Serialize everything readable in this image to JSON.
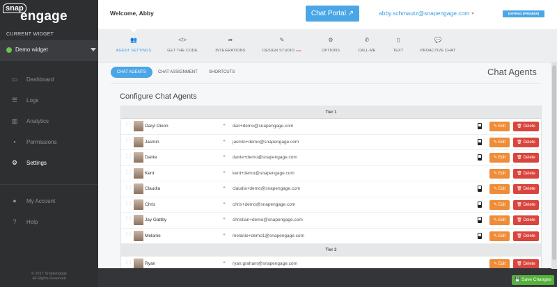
{
  "brand": {
    "logo_top": "snap",
    "logo_bottom": "engage"
  },
  "sidebar": {
    "current_widget_label": "CURRENT WIDGET",
    "widget_name": "Demo widget",
    "items": [
      {
        "label": "Dashboard",
        "icon": "monitor-icon"
      },
      {
        "label": "Logs",
        "icon": "list-icon"
      },
      {
        "label": "Analytics",
        "icon": "bar-chart-icon"
      },
      {
        "label": "Permissions",
        "icon": "lock-icon"
      },
      {
        "label": "Settings",
        "icon": "gear-icon",
        "active": true
      },
      {
        "label": "My Account",
        "icon": "user-icon"
      },
      {
        "label": "Help",
        "icon": "help-icon"
      }
    ],
    "copyright_line1": "© 2017 SnapEngage",
    "copyright_line2": "All Rights Reserved"
  },
  "header": {
    "welcome": "Welcome, Abby",
    "chat_portal_label": "Chat Portal",
    "email": "abby.schmautz@snapengage.com",
    "plan_badge": "EXPIRED (PREMIER)"
  },
  "tabs": [
    {
      "label": "AGENT SETTINGS",
      "icon": "users-icon",
      "glyph": "👥",
      "active": true
    },
    {
      "label": "GET THE CODE",
      "icon": "code-icon",
      "glyph": "</>"
    },
    {
      "label": "INTEGRATIONS",
      "icon": "share-icon",
      "glyph": "➦"
    },
    {
      "label": "DESIGN STUDIO",
      "icon": "magic-wand-icon",
      "glyph": "✎",
      "badge": "new"
    },
    {
      "label": "OPTIONS",
      "icon": "gears-icon",
      "glyph": "⚙"
    },
    {
      "label": "CALL-ME",
      "icon": "phone-icon",
      "glyph": "✆"
    },
    {
      "label": "TEXT",
      "icon": "mobile-icon",
      "glyph": "▯"
    },
    {
      "label": "PROACTIVE CHAT",
      "icon": "comment-icon",
      "glyph": "💬"
    }
  ],
  "subtabs": [
    "CHAT AGENTS",
    "CHAT ASSIGNMENT",
    "SHORTCUTS"
  ],
  "page_heading": "Chat Agents",
  "section_title": "Configure Chat Agents",
  "table": {
    "tier1_label": "Tier 1",
    "tier2_label": "Tier 2",
    "edit_label": "Edit",
    "delete_label": "Delete",
    "agents": [
      {
        "name": "Daryl Dixon",
        "email": "dan+demo@snapengage.com",
        "phone": true
      },
      {
        "name": "Jasmin",
        "email": "jasmin+demo@snapengage.com",
        "phone": true
      },
      {
        "name": "Dante",
        "email": "dante+demo@snapengage.com",
        "phone": true
      },
      {
        "name": "Kent",
        "email": "kent+demo@snapengage.com",
        "phone": false
      },
      {
        "name": "Claudia",
        "email": "claudia+demo@snapengage.com",
        "phone": true
      },
      {
        "name": "Chris",
        "email": "chris+demo@snapengage.com",
        "phone": true
      },
      {
        "name": "Jay Gattby",
        "email": "christian+demo@snapengage.com",
        "phone": true
      },
      {
        "name": "Melanie",
        "email": "melanie+demo1@snapengage.com",
        "phone": true
      }
    ],
    "tier2_agent": {
      "name": "Ryan",
      "email": "ryan.graham@snapengage.com"
    }
  },
  "footer": {
    "save_label": "Save Changes"
  }
}
